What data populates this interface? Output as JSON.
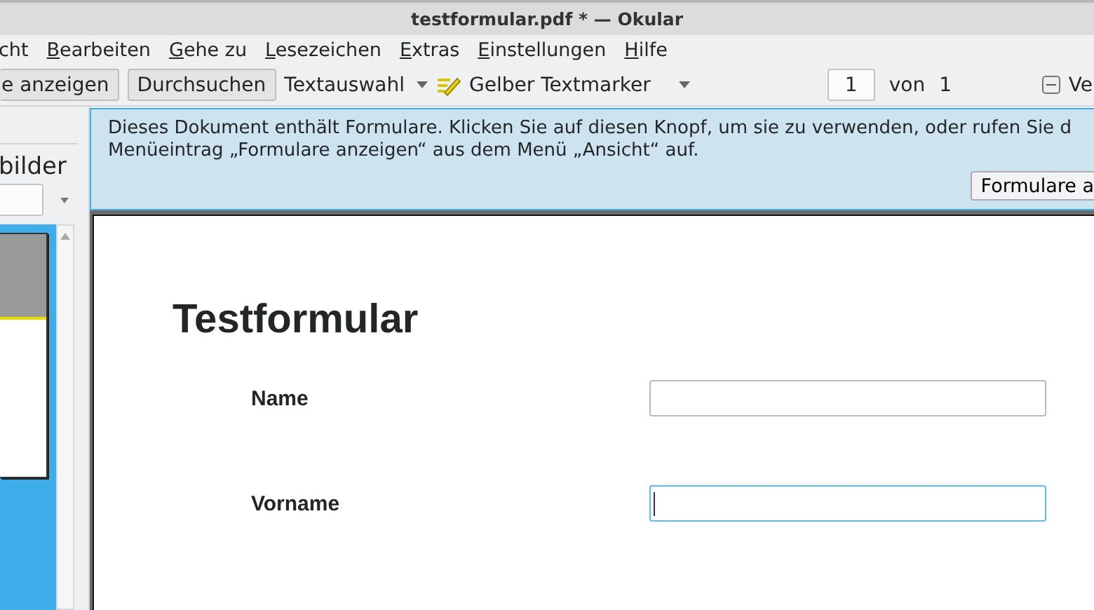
{
  "window": {
    "title": "testformular.pdf * — Okular"
  },
  "menu": [
    "cht",
    "Bearbeiten",
    "Gehe zu",
    "Lesezeichen",
    "Extras",
    "Einstellungen",
    "Hilfe"
  ],
  "toolbar": {
    "buttons": [
      {
        "label": "e anzeigen"
      },
      {
        "label": "Durchsuchen"
      }
    ],
    "selection_tool": "Textauswahl",
    "highlighter": "Gelber Textmarker",
    "page": "1",
    "of": "von",
    "total": "1",
    "cut_button": "Ve"
  },
  "sidebar": {
    "title": "bilder",
    "thumbnails": [
      {
        "selected": true
      }
    ]
  },
  "banner": {
    "text": "Dieses Dokument enthält Formulare. Klicken Sie auf diesen Knopf, um sie zu verwenden, oder rufen Sie d",
    "text2": "Menüeintrag „Formulare anzeigen“ aus dem Menü „Ansicht“ auf.",
    "button": "Formulare a"
  },
  "document": {
    "heading": "Testformular",
    "fields": [
      {
        "label": "Name",
        "focused": false
      },
      {
        "label": "Vorname",
        "focused": true
      }
    ]
  }
}
